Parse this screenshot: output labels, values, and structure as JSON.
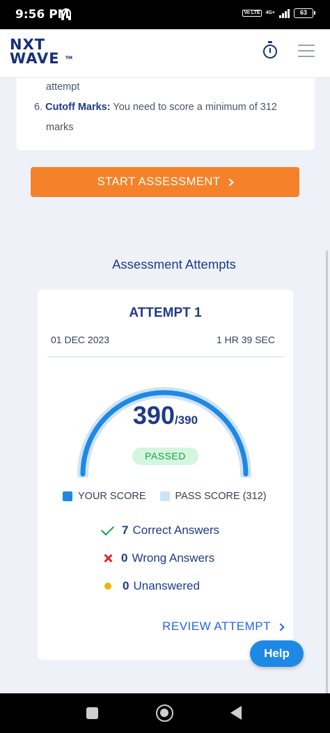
{
  "status_bar": {
    "time": "9:56 PM",
    "network": "4G+",
    "volte": "Vo LTE",
    "battery": "63"
  },
  "header": {
    "logo_line1": "NXT",
    "logo_line2": "WAVE",
    "logo_tm": "TM"
  },
  "instructions": {
    "partial_line": "attempt",
    "item_number": "6.",
    "item_title": "Cutoff Marks:",
    "item_text": "You need to score a minimum of 312",
    "item_text_cont": "marks"
  },
  "start_button": {
    "label": "START ASSESSMENT"
  },
  "attempts": {
    "section_title": "Assessment Attempts",
    "title": "ATTEMPT 1",
    "date": "01 DEC 2023",
    "duration": "1 HR 39 SEC",
    "score": "390",
    "total": "/390",
    "score_fraction": 1.0,
    "status": "PASSED",
    "legend": {
      "your_score": "YOUR SCORE",
      "pass_score": "PASS SCORE (312)"
    },
    "stats": {
      "correct_count": "7",
      "correct_label": "Correct Answers",
      "wrong_count": "0",
      "wrong_label": "Wrong Answers",
      "unanswered_count": "0",
      "unanswered_label": "Unanswered"
    },
    "review_label": "REVIEW ATTEMPT"
  },
  "help_button": {
    "label": "Help"
  },
  "colors": {
    "accent": "#f5822a",
    "brand": "#16307a",
    "gauge_fill": "#1e88e5",
    "gauge_track": "#cfe3f7",
    "pass": "#16a34a",
    "fail": "#dc2626",
    "pending": "#eab308"
  }
}
